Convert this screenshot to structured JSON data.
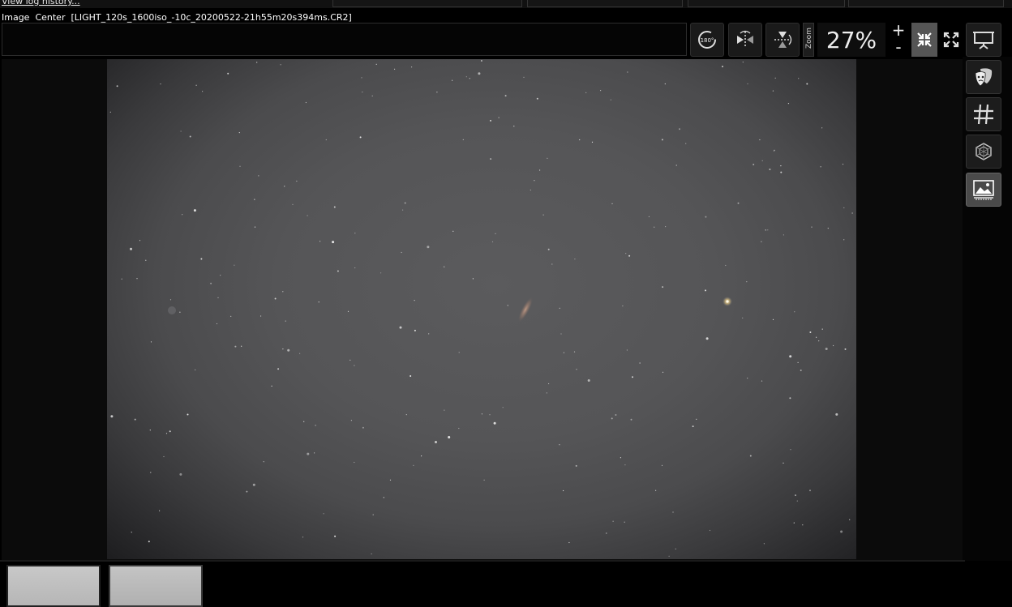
{
  "header": {
    "log_link": "View log history...",
    "image_title": "Image  Center  [LIGHT_120s_1600iso_-10c_20200522-21h55m20s394ms.CR2]"
  },
  "toolbar": {
    "rotate_label": "180°",
    "zoom_label": "Zoom",
    "zoom_value": "27%",
    "zoom_in": "+",
    "zoom_out": "-"
  },
  "icons": {
    "rotate": "rotate-180-icon",
    "flip_h": "flip-horizontal-icon",
    "flip_v": "flip-vertical-icon",
    "fit": "fit-to-window-icon",
    "fullscreen": "fullscreen-icon",
    "presentation": "presentation-icon",
    "mask": "theater-mask-icon",
    "grid": "grid-hash-icon",
    "cube": "cube-icon",
    "image": "image-landscape-icon"
  },
  "colors": {
    "background": "#000000",
    "panel": "#1a1a1a",
    "text": "#ffffff"
  }
}
